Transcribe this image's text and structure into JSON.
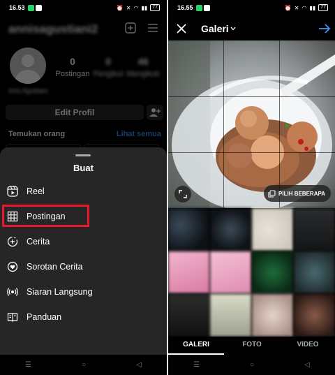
{
  "left": {
    "status": {
      "time": "16.53",
      "battery": "77"
    },
    "profile": {
      "username": "annisagustiani2",
      "stats": [
        {
          "value": "0",
          "label": "Postingan"
        },
        {
          "value": "0",
          "label": "Pengikut"
        },
        {
          "value": "46",
          "label": "Mengikuti"
        }
      ],
      "bio": "Anis Agustiani",
      "edit_button": "Edit Profil",
      "discover_title": "Temukan orang",
      "discover_link": "Lihat semua"
    },
    "sheet": {
      "title": "Buat",
      "items": [
        {
          "label": "Reel",
          "icon": "reel-icon"
        },
        {
          "label": "Postingan",
          "icon": "grid-post-icon"
        },
        {
          "label": "Cerita",
          "icon": "story-add-icon"
        },
        {
          "label": "Sorotan Cerita",
          "icon": "highlight-heart-icon"
        },
        {
          "label": "Siaran Langsung",
          "icon": "live-broadcast-icon"
        },
        {
          "label": "Panduan",
          "icon": "guide-book-icon"
        }
      ]
    }
  },
  "right": {
    "status": {
      "time": "16.55",
      "battery": "77"
    },
    "header": {
      "title": "Galeri"
    },
    "select_multiple": "PILIH BEBERAPA",
    "tabs": [
      "GALERI",
      "FOTO",
      "VIDEO"
    ],
    "active_tab": "GALERI"
  },
  "nav": {
    "menu": "☰",
    "home": "○",
    "back": "◁"
  },
  "colors": {
    "highlight_border": "#e8192c",
    "link_blue": "#3797f0",
    "next_arrow": "#3797f0",
    "sheet_bg": "#262626"
  }
}
